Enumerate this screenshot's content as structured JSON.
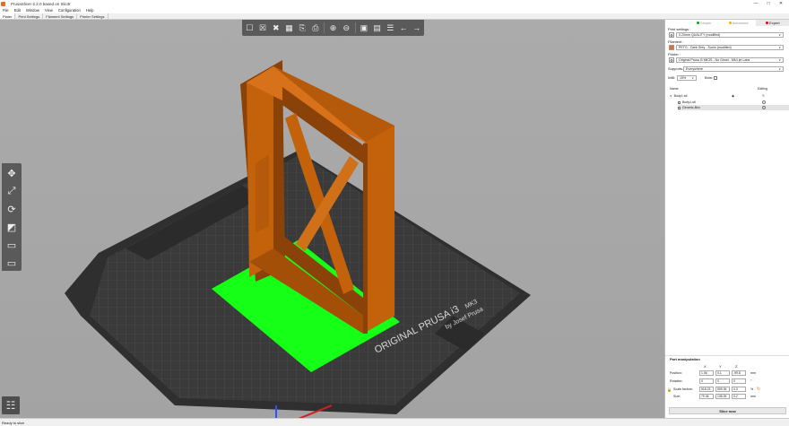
{
  "window": {
    "title": "PrusaSlicer-2.2.0 based on Slic3r",
    "min_glyph": "—",
    "max_glyph": "□",
    "close_glyph": "✕"
  },
  "menu": [
    "File",
    "Edit",
    "Window",
    "View",
    "Configuration",
    "Help"
  ],
  "tabs": [
    "Plater",
    "Print Settings",
    "Filament Settings",
    "Printer Settings"
  ],
  "mode_tabs": [
    {
      "label": "Simple",
      "color": "#00b000"
    },
    {
      "label": "Advanced",
      "color": "#ffb000"
    },
    {
      "label": "Expert",
      "color": "#e00000"
    }
  ],
  "settings": {
    "print_label": "Print settings :",
    "print_value": "0.20mm QUALITY (modified)",
    "filament_label": "Filament :",
    "filament_value": "PETG - Dark Grey - Sunlu (modified)",
    "filament_color": "#ed6b21",
    "printer_label": "Printer :",
    "printer_value": "Original Prusa i3 MK3S - No Ghost - Mk4 jet Labs",
    "supports_label": "Supports:",
    "supports_value": "Everywhere",
    "infill_label": "Infill:",
    "infill_value": "15%",
    "brim_label": "Brim:"
  },
  "object_list": {
    "name_header": "Name",
    "editing_header": "Editing",
    "rows": [
      "Body1.stl",
      "Body1.stl",
      "Generic-Box"
    ]
  },
  "part_manipulation": {
    "title": "Part manipulation",
    "axes": [
      "X",
      "Y",
      "Z"
    ],
    "rows": [
      {
        "label": "Position:",
        "values": [
          "1.06",
          "0.1",
          "-99.8"
        ],
        "unit": "mm"
      },
      {
        "label": "Rotation:",
        "values": [
          "0",
          "0",
          "0"
        ],
        "unit": "°"
      },
      {
        "label": "Scale factors:",
        "values": [
          "518.23",
          "509.36",
          "0.3"
        ],
        "unit": "%"
      },
      {
        "label": "Size:",
        "values": [
          "79.36",
          "138.39",
          "0.2"
        ],
        "unit": "mm"
      }
    ]
  },
  "slice_button": "Slice now",
  "status": "Ready to slice",
  "bed_text": {
    "brand": "ORIGINAL PRUSA i3",
    "model": "MK3",
    "maker": "by Josef Prusa"
  },
  "colors": {
    "model": "#c4620c",
    "model_dark": "#8a4208",
    "modifier": "#16ff16",
    "bed": "#353535",
    "viewport_bg": "#a8a8a8"
  },
  "toolbar_icons": [
    "add-icon",
    "delete-icon",
    "delete-all-icon",
    "arrange-icon",
    "copy-icon",
    "paste-icon",
    "add-instance-icon",
    "remove-instance-icon",
    "split-objects-icon",
    "split-parts-icon",
    "layers-editing-icon",
    "undo-icon",
    "redo-icon"
  ],
  "gizmo_icons": [
    "move-icon",
    "scale-icon",
    "rotate-icon",
    "place-on-face-icon",
    "cut-icon",
    "support-painting-icon"
  ]
}
